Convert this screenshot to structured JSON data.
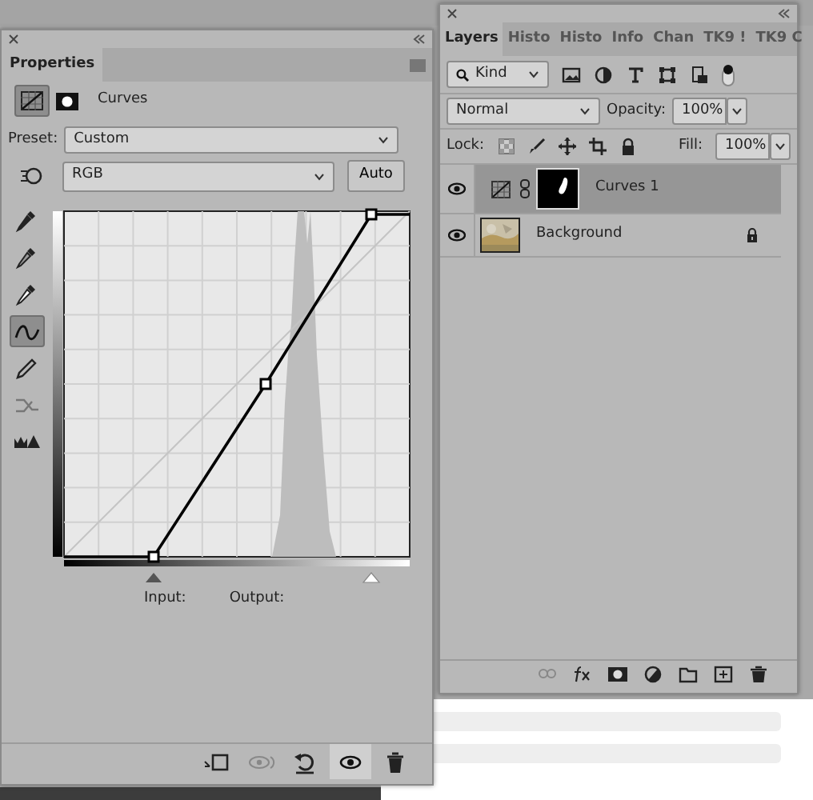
{
  "properties": {
    "title": "Properties",
    "adjustment": "Curves",
    "preset_label": "Preset:",
    "preset": "Custom",
    "channel": "RGB",
    "auto_button": "Auto",
    "tools": [
      {
        "kind": "target",
        "selected": false
      },
      {
        "kind": "dropper-black",
        "selected": false
      },
      {
        "kind": "dropper-gray",
        "selected": false
      },
      {
        "kind": "dropper-white",
        "selected": false
      },
      {
        "kind": "curve",
        "selected": true
      },
      {
        "kind": "pencil",
        "selected": false
      },
      {
        "kind": "smooth",
        "selected": false
      },
      {
        "kind": "warning",
        "selected": false
      }
    ],
    "input_label": "Input:",
    "output_label": "Output:",
    "footer": [
      {
        "kind": "clip",
        "selected": false
      },
      {
        "kind": "view-previous",
        "selected": false
      },
      {
        "kind": "reset",
        "selected": false
      },
      {
        "kind": "visibility",
        "selected": true
      },
      {
        "kind": "delete",
        "selected": false
      }
    ]
  },
  "layers_panel": {
    "tabs": [
      {
        "label": "Layers",
        "selected": true
      },
      {
        "label": "Histo",
        "selected": false
      },
      {
        "label": "Histo",
        "selected": false
      },
      {
        "label": "Info",
        "selected": false
      },
      {
        "label": "Chan",
        "selected": false
      },
      {
        "label": "TK9 !",
        "selected": false
      },
      {
        "label": "TK9 C",
        "selected": false
      }
    ],
    "filter": "Kind",
    "blend_mode": "Normal",
    "opacity_label": "Opacity:",
    "opacity": "100%",
    "lock_label": "Lock:",
    "fill_label": "Fill:",
    "fill": "100%",
    "layers": [
      {
        "name": "Curves 1",
        "kind": "adjustment",
        "selected": true,
        "visible": true,
        "locked": false
      },
      {
        "name": "Background",
        "selected": false,
        "visible": true,
        "locked": true
      }
    ]
  }
}
